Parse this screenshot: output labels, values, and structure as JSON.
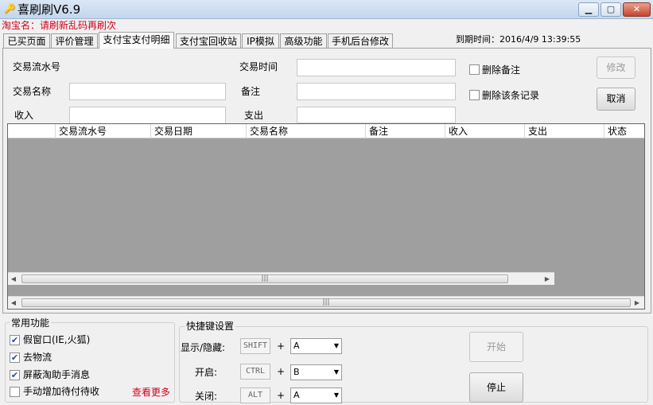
{
  "window": {
    "title": "喜刷刷V6.9",
    "icon": "app-key-icon",
    "controls": {
      "minimize": "▁",
      "maximize": "▢",
      "close": "✕"
    }
  },
  "shop": {
    "label": "淘宝名：请刷新乱码再刷次"
  },
  "tabs": [
    {
      "label": "已买页面",
      "active": false
    },
    {
      "label": "评价管理",
      "active": false
    },
    {
      "label": "支付宝支付明细",
      "active": true
    },
    {
      "label": "支付宝回收站",
      "active": false
    },
    {
      "label": "IP模拟",
      "active": false
    },
    {
      "label": "高级功能",
      "active": false
    },
    {
      "label": "手机后台修改",
      "active": false
    }
  ],
  "expiry": {
    "text": "到期时间：2016/4/9 13:39:55"
  },
  "form": {
    "serial_label": "交易流水号",
    "name_label": "交易名称",
    "income_label": "收入",
    "time_label": "交易时间",
    "remark_label": "备注",
    "expense_label": "支出",
    "delete_remark": "删除备注",
    "delete_record": "删除该条记录",
    "modify_button": "修改",
    "cancel_button": "取消"
  },
  "grid": {
    "columns": [
      "交易流水号",
      "交易日期",
      "交易名称",
      "备注",
      "收入",
      "支出",
      "状态"
    ],
    "rows": []
  },
  "common": {
    "title": "常用功能",
    "items": [
      {
        "label": "假窗口(IE,火狐)",
        "checked": true
      },
      {
        "label": "去物流",
        "checked": true
      },
      {
        "label": "屏蔽淘助手消息",
        "checked": true
      },
      {
        "label": "手动增加待付待收",
        "checked": false
      }
    ],
    "more_link": "查看更多"
  },
  "hotkeys": {
    "title": "快捷键设置",
    "plus": "+",
    "rows": [
      {
        "label": "显示/隐藏:",
        "modifier": "SHIFT",
        "key": "A"
      },
      {
        "label": "开启:",
        "modifier": "CTRL",
        "key": "B"
      },
      {
        "label": "关闭:",
        "modifier": "ALT",
        "key": "A"
      }
    ]
  },
  "actions": {
    "start": "开始",
    "stop": "停止"
  },
  "colors": {
    "accent_red": "#d0021b",
    "grid_bg": "#9f9f9f"
  }
}
